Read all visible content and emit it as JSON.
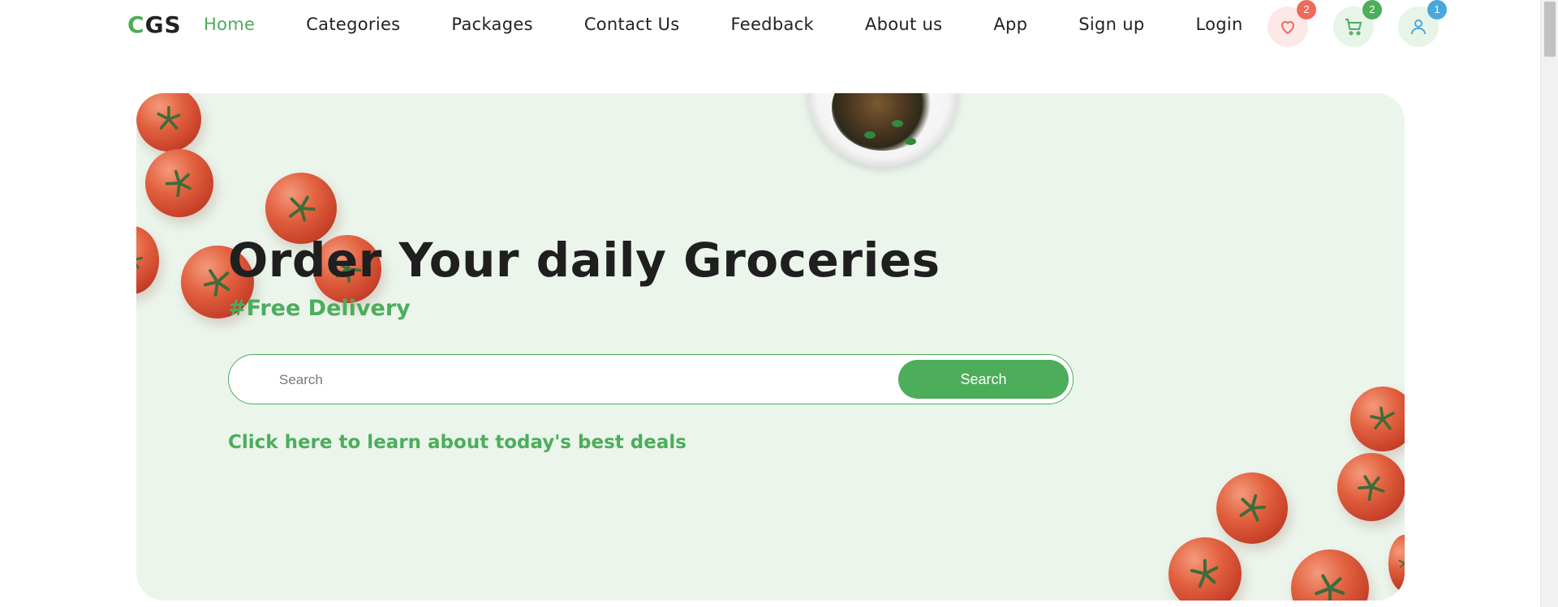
{
  "brand": {
    "logo_first": "C",
    "logo_rest": "GS"
  },
  "nav": {
    "links": [
      {
        "label": "Home",
        "active": true
      },
      {
        "label": "Categories"
      },
      {
        "label": "Packages"
      },
      {
        "label": "Contact Us"
      },
      {
        "label": "Feedback"
      },
      {
        "label": "About us"
      },
      {
        "label": "App"
      },
      {
        "label": "Sign up"
      },
      {
        "label": "Login"
      }
    ],
    "icons": [
      {
        "name": "heart-icon",
        "badge": "2",
        "color": "#f06a5b"
      },
      {
        "name": "cart-icon",
        "badge": "2",
        "color": "#4cad5b"
      },
      {
        "name": "user-icon",
        "badge": "1",
        "color": "#4aa7dd"
      }
    ]
  },
  "hero": {
    "title": "Order Your daily Groceries",
    "subtitle": "#Free Delivery",
    "search_placeholder": "Search",
    "search_button": "Search",
    "deals_link": "Click here to learn about today's best deals"
  },
  "colors": {
    "accent": "#4cad5b",
    "hero_bg": "#ebf5ec",
    "heading": "#1f1f1f"
  }
}
